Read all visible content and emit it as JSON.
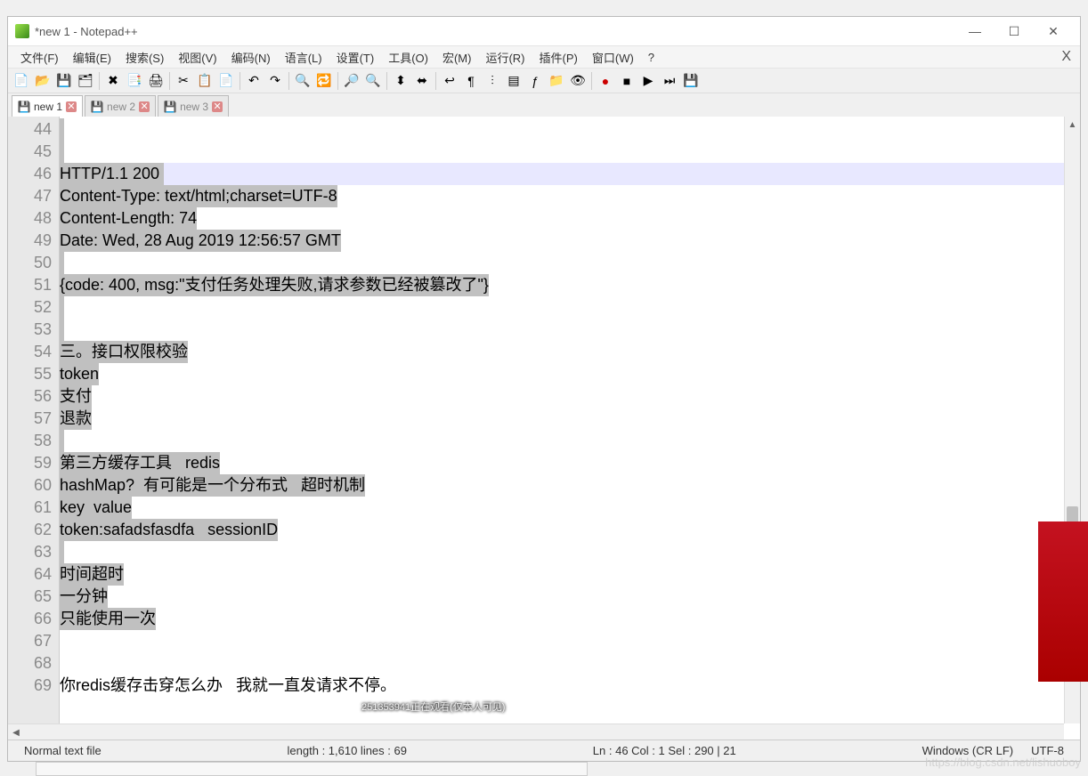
{
  "window": {
    "title": "*new 1 - Notepad++"
  },
  "menu": {
    "file": "文件(F)",
    "edit": "编辑(E)",
    "search": "搜索(S)",
    "view": "视图(V)",
    "encoding": "编码(N)",
    "language": "语言(L)",
    "settings": "设置(T)",
    "tools": "工具(O)",
    "macro": "宏(M)",
    "run": "运行(R)",
    "plugins": "插件(P)",
    "window": "窗口(W)",
    "help": "?"
  },
  "tabs": [
    {
      "label": "new 1",
      "modified": true,
      "active": true
    },
    {
      "label": "new 2",
      "modified": false,
      "active": false
    },
    {
      "label": "new 3",
      "modified": false,
      "active": false
    }
  ],
  "editor": {
    "first_line": 44,
    "current_line": 46,
    "lines": [
      "",
      "",
      "HTTP/1.1 200 ",
      "Content-Type: text/html;charset=UTF-8",
      "Content-Length: 74",
      "Date: Wed, 28 Aug 2019 12:56:57 GMT",
      "",
      "{code: 400, msg:\"支付任务处理失败,请求参数已经被篡改了\"}",
      "",
      "",
      "三。接口权限校验",
      "token",
      "支付",
      "退款",
      "",
      "第三方缓存工具   redis",
      "hashMap?  有可能是一个分布式   超时机制",
      "key  value",
      "token:safadsfasdfa   sessionID",
      "",
      "时间超时",
      "一分钟",
      "只能使用一次",
      "",
      "",
      "你redis缓存击穿怎么办   我就一直发请求不停。"
    ],
    "selection_active_rows": [
      44,
      45,
      46,
      47,
      48,
      49,
      50,
      51,
      52,
      53,
      54,
      55,
      56,
      57,
      58,
      59,
      60,
      61,
      62,
      63,
      64,
      65,
      66
    ]
  },
  "status": {
    "mode": "Normal text file",
    "length": "length : 1,610    lines : 69",
    "pos": "Ln : 46    Col : 1    Sel : 290 | 21",
    "eol": "Windows (CR LF)",
    "enc": "UTF-8"
  },
  "overlay": {
    "center": "251353941正在观看(仅本人可见)",
    "br": "https://blog.csdn.net/lishuoboy"
  }
}
